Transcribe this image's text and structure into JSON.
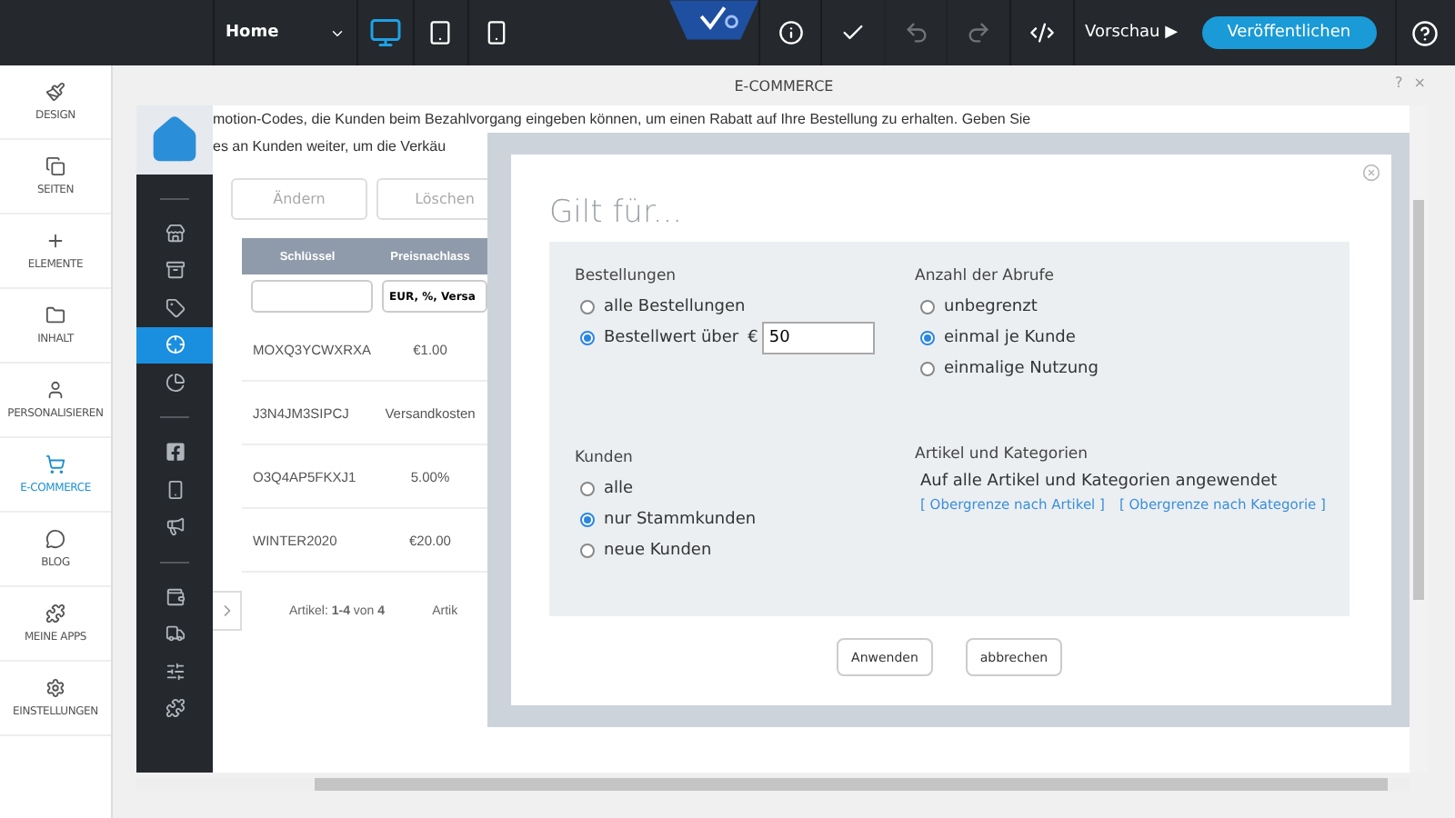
{
  "toolbar": {
    "page_select": "Home",
    "devices": [
      {
        "kind": "desktop",
        "selected": true
      },
      {
        "kind": "tablet",
        "selected": false
      },
      {
        "kind": "phone",
        "selected": false
      }
    ],
    "actions": [
      {
        "kind": "info",
        "disabled": false
      },
      {
        "kind": "check",
        "disabled": false
      },
      {
        "kind": "undo",
        "disabled": true
      },
      {
        "kind": "redo",
        "disabled": true
      },
      {
        "kind": "code",
        "disabled": false
      }
    ],
    "preview": {
      "label": "Vorschau",
      "icon": "▶"
    },
    "publish": "Veröffentlichen"
  },
  "sidebar": {
    "items": [
      {
        "kind": "brush",
        "label": "DESIGN",
        "selected": false
      },
      {
        "kind": "pages",
        "label": "SEITEN",
        "selected": false
      },
      {
        "kind": "plus",
        "label": "ELEMENTE",
        "selected": false
      },
      {
        "kind": "folder",
        "label": "INHALT",
        "selected": false
      },
      {
        "kind": "person",
        "label": "PERSONALISIEREN",
        "selected": false
      },
      {
        "kind": "cart",
        "label": "E-COMMERCE",
        "selected": true
      },
      {
        "kind": "chat",
        "label": "BLOG",
        "selected": false
      },
      {
        "kind": "puzzle",
        "label": "MEINE APPS",
        "selected": false
      },
      {
        "kind": "gear",
        "label": "EINSTELLUNGEN",
        "selected": false
      }
    ]
  },
  "panel": {
    "title": "E-COMMERCE",
    "help": "?",
    "close": "×"
  },
  "rail": {
    "items": [
      {
        "kind": "divider"
      },
      {
        "kind": "store",
        "selected": false
      },
      {
        "kind": "archive",
        "selected": false
      },
      {
        "kind": "tag",
        "selected": false
      },
      {
        "kind": "target",
        "selected": true
      },
      {
        "kind": "pie",
        "selected": false
      },
      {
        "kind": "divider"
      },
      {
        "kind": "facebook",
        "selected": false
      },
      {
        "kind": "phone",
        "selected": false
      },
      {
        "kind": "megaphone",
        "selected": false
      },
      {
        "kind": "divider"
      },
      {
        "kind": "wallet",
        "selected": false
      },
      {
        "kind": "truck",
        "selected": false
      },
      {
        "kind": "sliders",
        "selected": false
      },
      {
        "kind": "puzzle",
        "selected": false
      }
    ]
  },
  "intro": [
    "motion-Codes, die Kunden beim Bezahlvorgang eingeben können, um einen Rabatt auf Ihre Bestellung zu erhalten. Geben Sie",
    "es an Kunden weiter, um die Verkäu"
  ],
  "buttons": [
    "Ändern",
    "Löschen"
  ],
  "table": {
    "columns": [
      "Schlüssel",
      "Preisnachlass"
    ],
    "discount_filter": "EUR, %, Versa",
    "rows": [
      [
        "MOXQ3YCWXRXA",
        "€1.00"
      ],
      [
        "J3N4JM3SIPCJ",
        "Versandkosten"
      ],
      [
        "O3Q4AP5FKXJ1",
        "5.00%"
      ],
      [
        "WINTER2020",
        "€20.00"
      ]
    ]
  },
  "pagination": {
    "summary": "Artikel: **1-4** von **4**",
    "column_2": "Artik"
  },
  "dialog": {
    "title": "Gilt für...",
    "groups": [
      {
        "title": "Bestellungen",
        "options": [
          {
            "label": "alle Bestellungen",
            "selected": false
          },
          {
            "label": "Bestellwert über",
            "selected": true,
            "currency": "€",
            "value": "50"
          }
        ]
      },
      {
        "title": "Anzahl der Abrufe",
        "options": [
          {
            "label": "unbegrenzt",
            "selected": false
          },
          {
            "label": "einmal je Kunde",
            "selected": true
          },
          {
            "label": "einmalige Nutzung",
            "selected": false
          }
        ]
      },
      {
        "title": "Kunden",
        "options": [
          {
            "label": "alle",
            "selected": false
          },
          {
            "label": "nur Stammkunden",
            "selected": true
          },
          {
            "label": "neue Kunden",
            "selected": false
          }
        ]
      }
    ],
    "articles": {
      "title": "Artikel und Kategorien",
      "text": "Auf alle Artikel und Kategorien angewendet",
      "links": [
        "[ Obergrenze nach Artikel ]",
        "[ Obergrenze nach Kategorie ]"
      ]
    },
    "buttons": [
      "Anwenden",
      "abbrechen"
    ]
  }
}
